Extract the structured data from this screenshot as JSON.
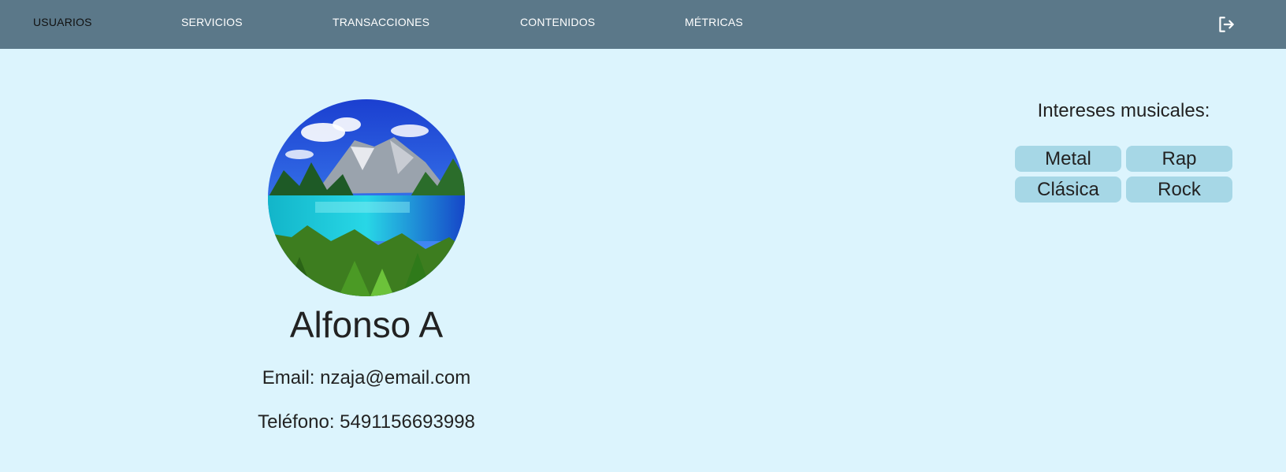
{
  "nav": {
    "items": [
      {
        "label": "USUARIOS",
        "active": true
      },
      {
        "label": "SERVICIOS",
        "active": false
      },
      {
        "label": "TRANSACCIONES",
        "active": false
      },
      {
        "label": "CONTENIDOS",
        "active": false
      },
      {
        "label": "MÉTRICAS",
        "active": false
      }
    ],
    "logout_icon": "logout-icon"
  },
  "profile": {
    "avatar_icon": "mountain-lake-photo",
    "name": "Alfonso A",
    "email_line": "Email: nzaja@email.com",
    "phone_line": "Teléfono: 5491156693998"
  },
  "interests": {
    "title": "Intereses musicales:",
    "tags": [
      "Metal",
      "Rap",
      "Clásica",
      "Rock"
    ]
  },
  "colors": {
    "navbar": "#5b7889",
    "background": "#dcf4fd",
    "tag": "#a6d7e6",
    "active_nav_text": "#111111"
  }
}
